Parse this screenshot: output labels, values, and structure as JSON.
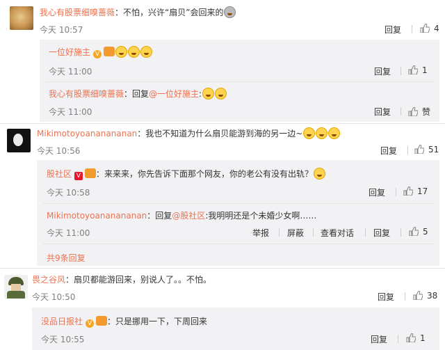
{
  "comments": [
    {
      "name": "我心有股票细嗅蔷薇",
      "text": "：不怕，兴许“扇贝”会回来的",
      "time": "今天 10:57",
      "reply_label": "回复",
      "likes": "4",
      "replies": [
        {
          "name": "一位好施主",
          "text": "",
          "time": "今天 11:00",
          "reply_label": "回复",
          "likes": "1"
        },
        {
          "name": "我心有股票细嗅蔷薇",
          "text": "：回复",
          "mention": "@一位好施主",
          "text2": ":",
          "time": "今天 11:00",
          "reply_label": "回复",
          "likes": "赞"
        }
      ]
    },
    {
      "name": "Mikimotoyoananananan",
      "text": "：我也不知道为什么扇贝能游到海的另一边~",
      "time": "今天 10:56",
      "reply_label": "回复",
      "likes": "51",
      "replies": [
        {
          "name": "股社区",
          "text": "：来来来，你先告诉下面那个网友，你的老公有没有出轨？",
          "time": "今天 10:58",
          "reply_label": "回复",
          "likes": "17"
        },
        {
          "name": "Mikimotoyoananananan",
          "text": "：回复",
          "mention": "@股社区",
          "text2": ":我明明还是个未婚少女啊……",
          "time": "今天 11:00",
          "report_label": "举报",
          "block_label": "屏蔽",
          "dialog_label": "查看对话",
          "reply_label": "回复",
          "likes": "5"
        }
      ],
      "more_replies": "共9条回复"
    },
    {
      "name": "畏之谷风",
      "text": "：扇贝都能游回来，别说人了。。不怕。",
      "time": "今天 10:50",
      "reply_label": "回复",
      "likes": "38",
      "replies": [
        {
          "name": "没品日报社",
          "text": "：只是挪用一下，下周回来",
          "time": "今天 10:55",
          "reply_label": "回复",
          "likes": "1"
        }
      ]
    }
  ],
  "colors": {
    "username": "#eb7350",
    "reply_bg": "#f2f2f5",
    "meta": "#808080"
  },
  "icons": {
    "like": "thumbs-up-icon",
    "emoji": "laughing-face-icon",
    "verified": "verified-v-icon"
  }
}
